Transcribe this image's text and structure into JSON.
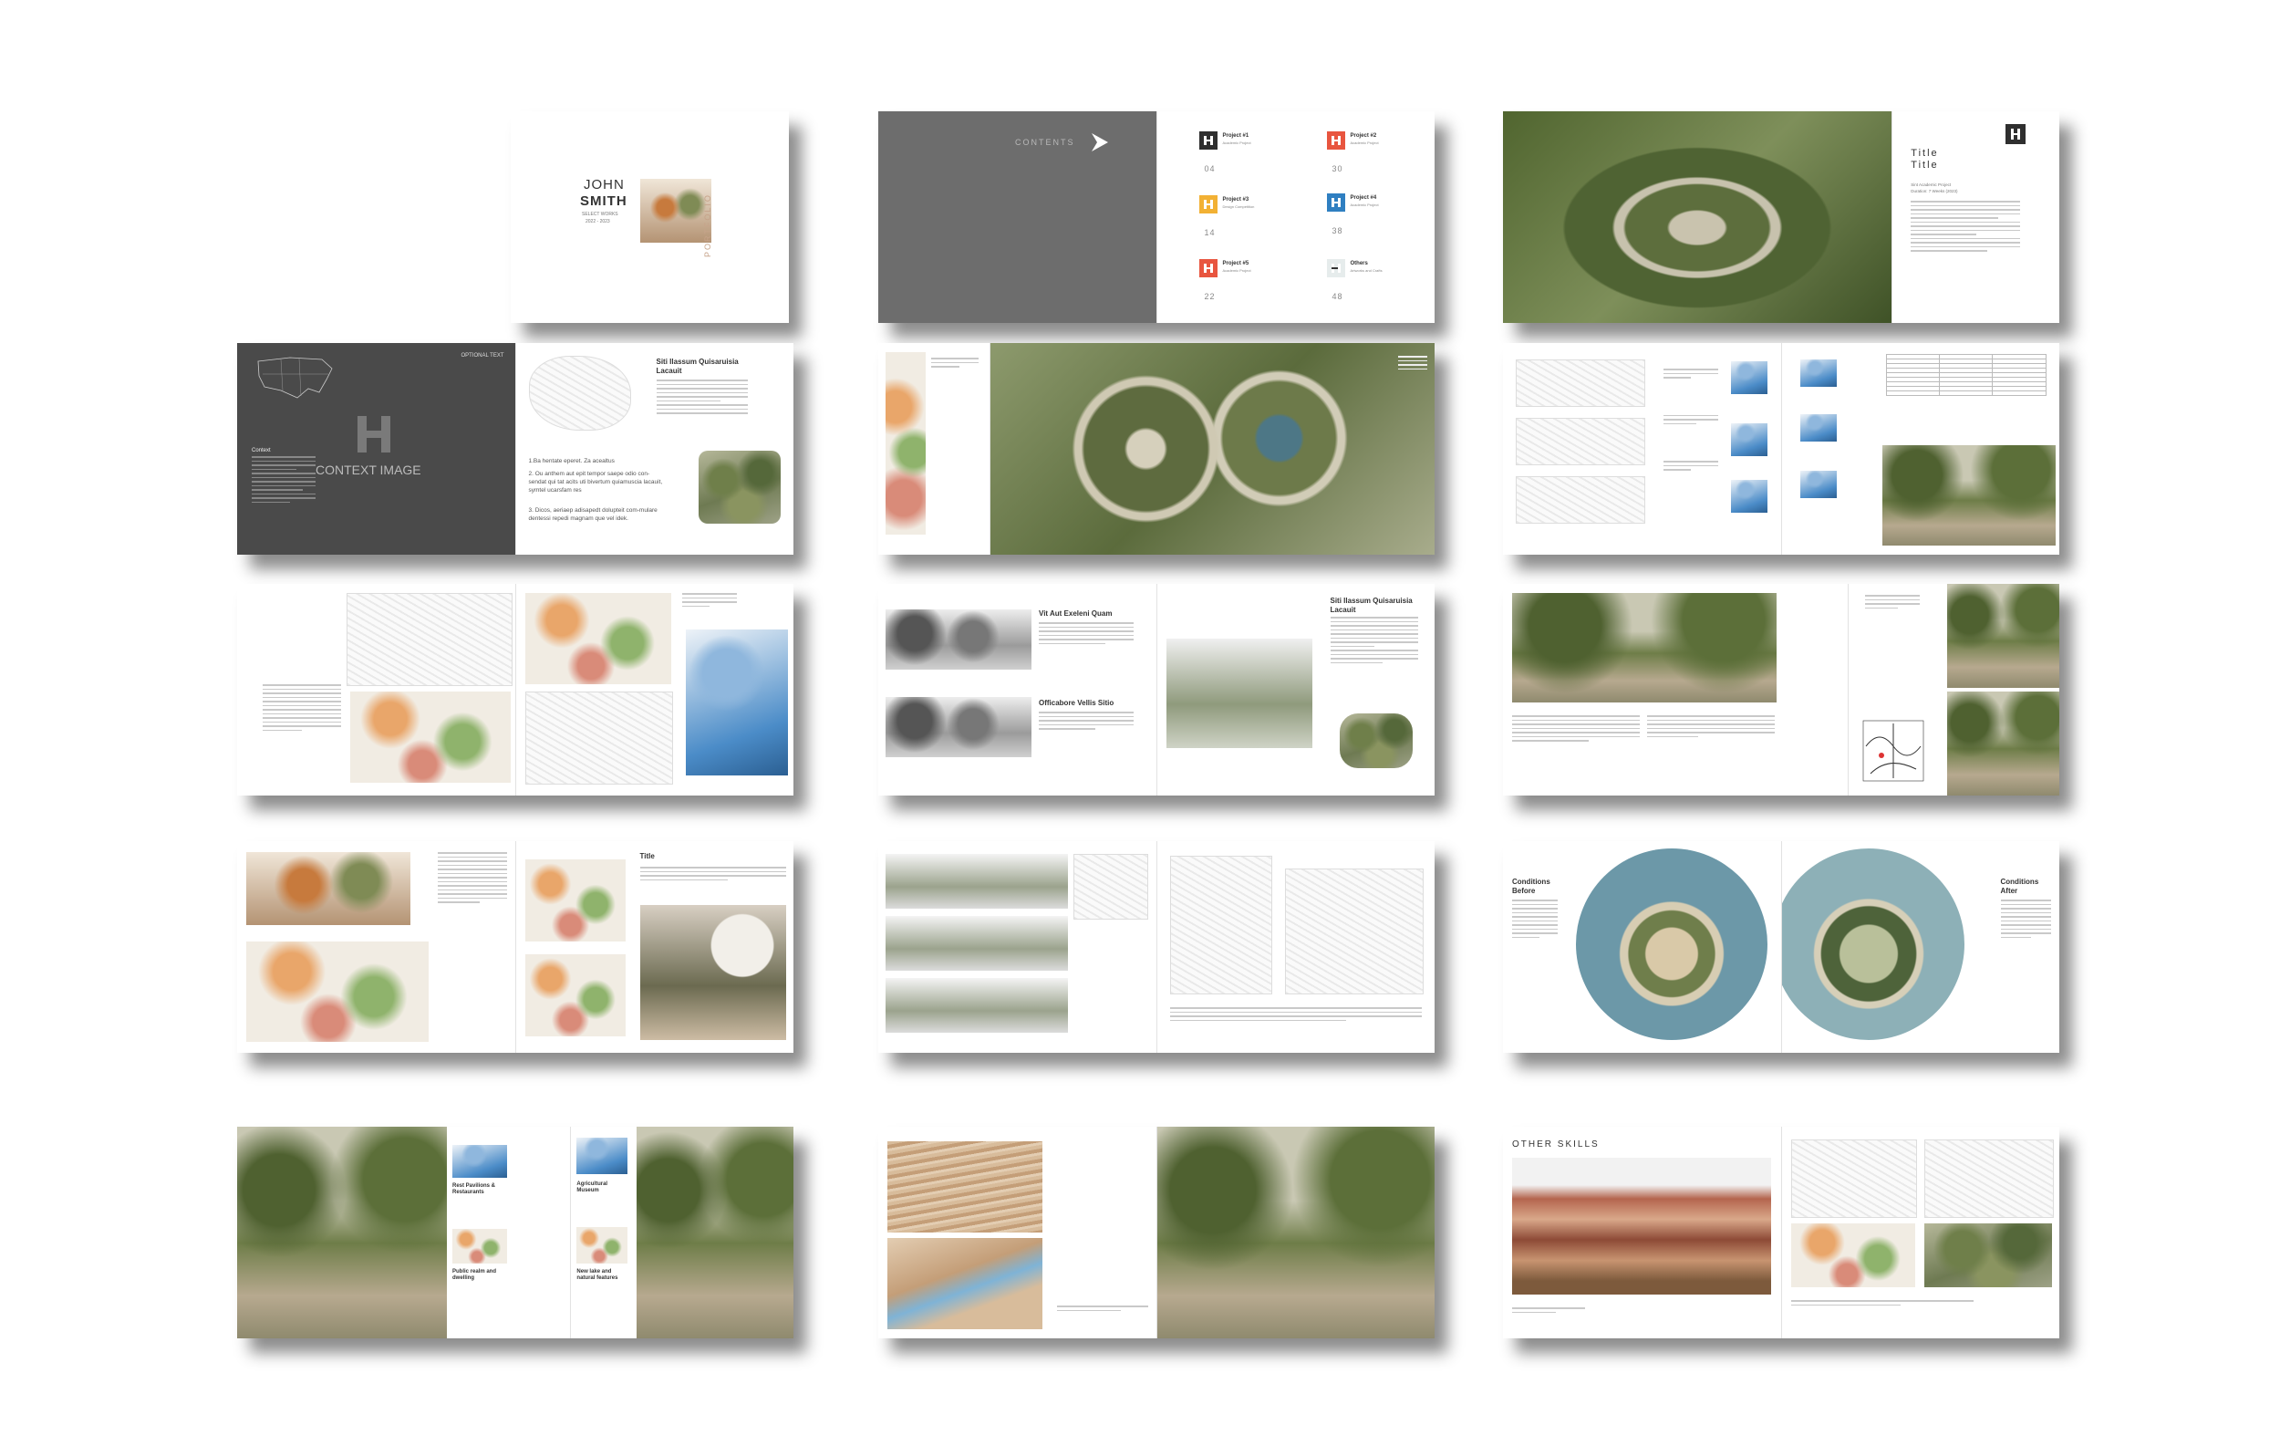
{
  "cover": {
    "first_name": "JOHN",
    "last_name": "SMITH",
    "subtitle": "SELECT WORKS",
    "years": "2022 - 2023",
    "side_title": "PORTFOLIO"
  },
  "contents": {
    "label": "CONTENTS",
    "arrow": "chevron-right-icon",
    "items": [
      {
        "title": "Project #1",
        "subtitle": "Academic Project",
        "page": "04",
        "color": "#2f2f2f"
      },
      {
        "title": "Project #2",
        "subtitle": "Academic Project",
        "page": "30",
        "color": "#e8553f"
      },
      {
        "title": "Project #3",
        "subtitle": "Design Competition",
        "page": "14",
        "color": "#f2b134"
      },
      {
        "title": "Project #4",
        "subtitle": "Academic Project",
        "page": "38",
        "color": "#2f7fc1"
      },
      {
        "title": "Project #5",
        "subtitle": "Academic Project",
        "page": "22",
        "color": "#e8553f"
      },
      {
        "title": "Others",
        "subtitle": "Artworks and Crafts",
        "page": "48",
        "color": "#e6ecec"
      }
    ]
  },
  "project_title": {
    "line1": "Title",
    "line2": "Title",
    "meta1": "Sint Academic Project",
    "meta2": "Duration: 7 Weeks (2023)"
  },
  "context": {
    "optional": "OPTIONAL TEXT",
    "image_label": "CONTEXT IMAGE",
    "section_label": "Context",
    "heading": "Siti Ilassum Quisaruisia Lacauit",
    "points": [
      "1.Ba hentate eperet. Za acealtus",
      "2. Ou anthem aut epit tempor saepe odio con-sendat qui tat acits uti bivertum quiamuscia lacauit, symtel ucarsfam res",
      "3. Dicos, aeriaep adisapedt dolupteit com-mulare dentessi repedi magnam que vel idek."
    ]
  },
  "sections": {
    "vit_aut": "Vit Aut Exeleni Quam",
    "officabore": "Officabore Vellis Sitio",
    "siti": "Siti Ilassum Quisaruisia Lacauit",
    "title_small": "Title",
    "before": "Conditions Before",
    "after": "Conditions After",
    "rest": "Rest Pavilions & Restaurants",
    "agri": "Agricultural Museum",
    "public": "Public realm and dwelling",
    "lake": "New lake and natural features",
    "other_skills": "OTHER SKILLS"
  }
}
